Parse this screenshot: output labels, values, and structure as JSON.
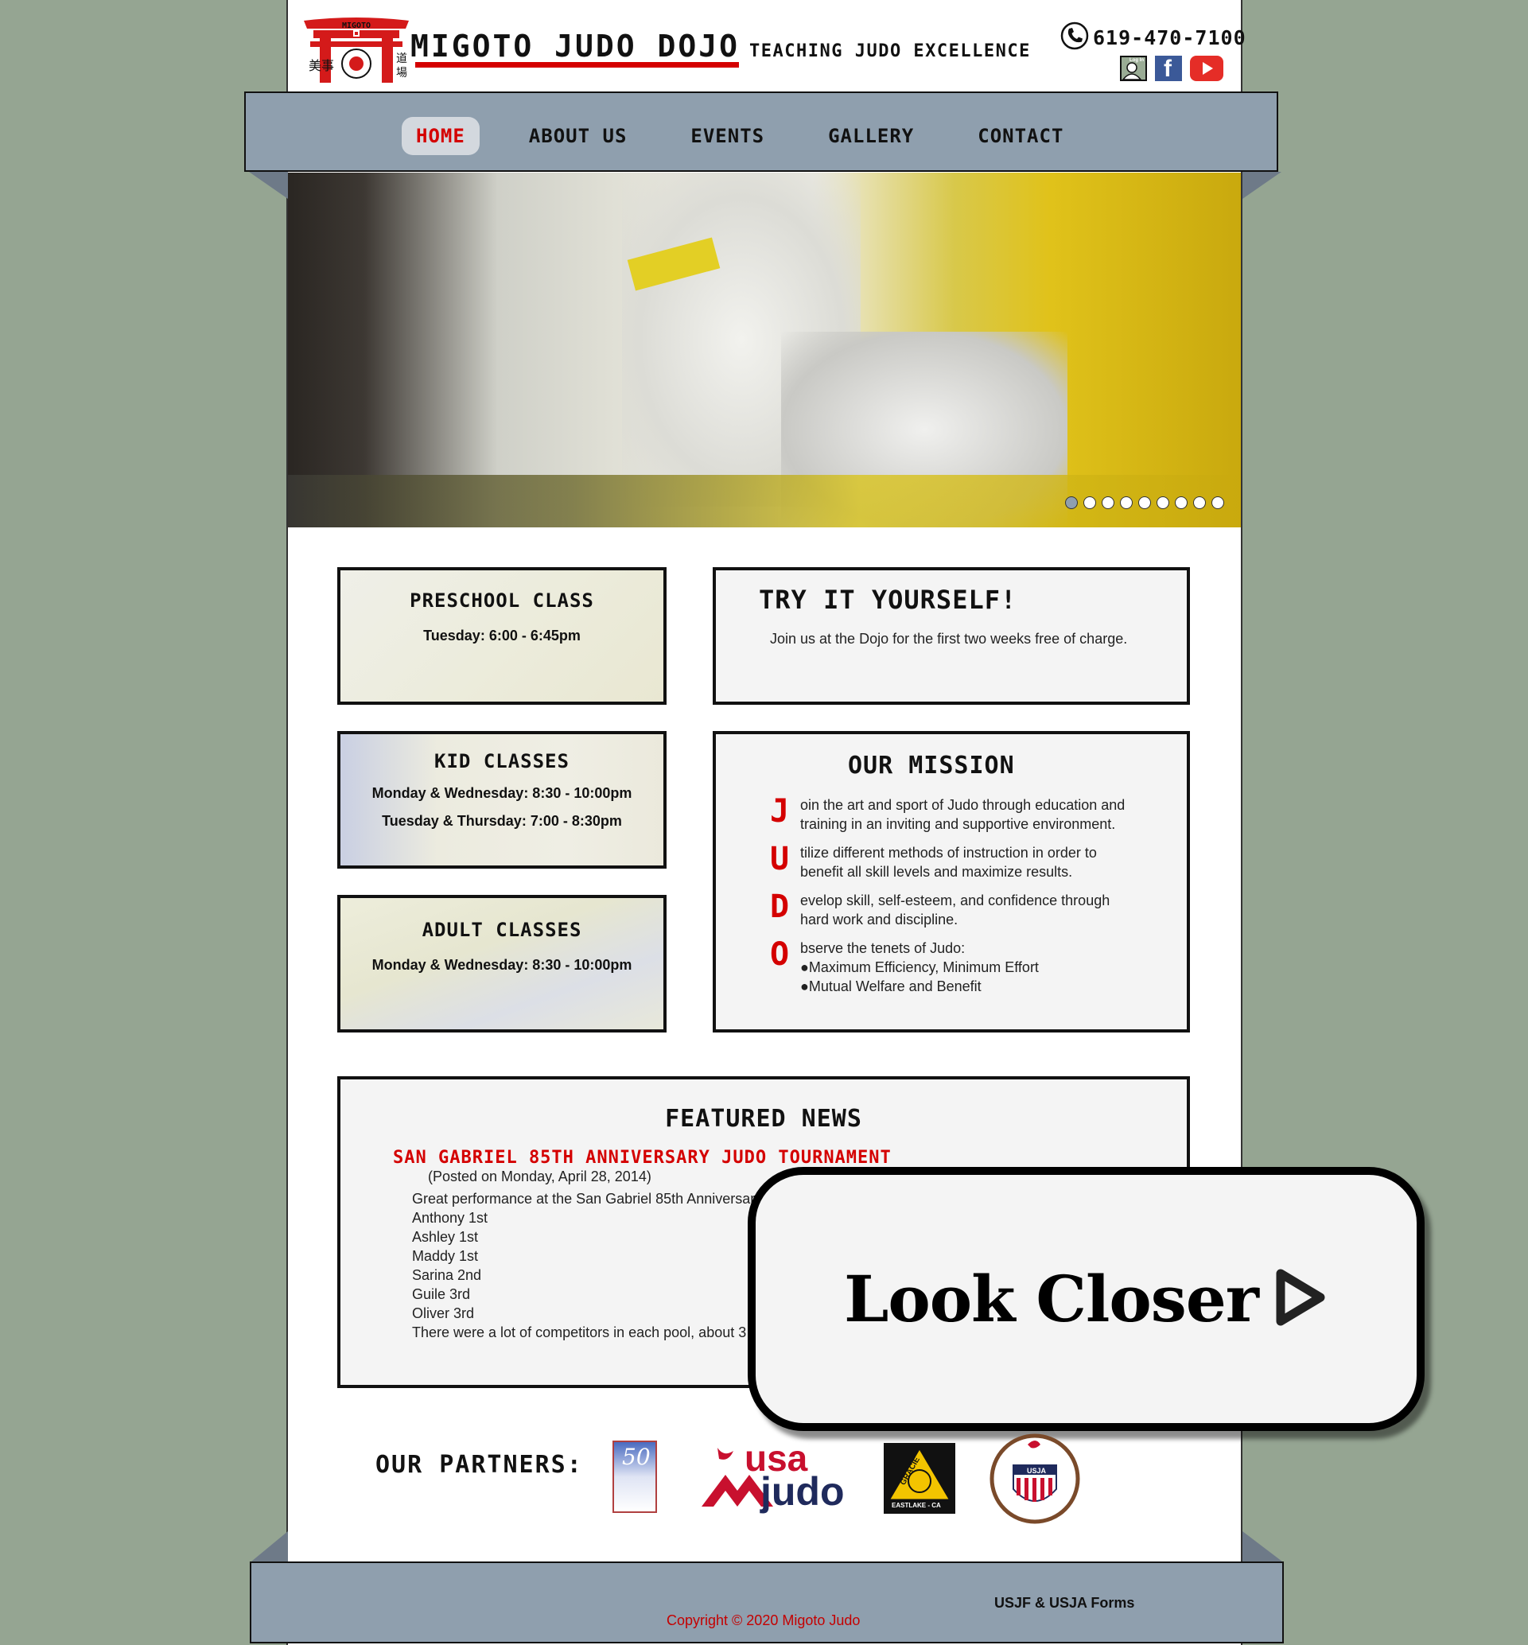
{
  "header": {
    "site_title": "Migoto Judo Dojo",
    "tagline": "Teaching Judo Excellence",
    "phone": "619-470-7100",
    "login_label": "Log In",
    "logo_text": "MIGOTO",
    "brand_red": "#d40000"
  },
  "nav": {
    "items": [
      {
        "label": "Home",
        "active": true
      },
      {
        "label": "About Us",
        "active": false
      },
      {
        "label": "Events",
        "active": false
      },
      {
        "label": "Gallery",
        "active": false
      },
      {
        "label": "Contact",
        "active": false
      }
    ]
  },
  "slideshow": {
    "slide_count": 9,
    "active_index": 0
  },
  "classes": [
    {
      "title": "Preschool Class",
      "schedule": [
        "Tuesday: 6:00 - 6:45pm"
      ]
    },
    {
      "title": "Kid Classes",
      "schedule": [
        "Monday & Wednesday: 8:30 - 10:00pm",
        "Tuesday & Thursday: 7:00 - 8:30pm"
      ]
    },
    {
      "title": "Adult Classes",
      "schedule": [
        "Monday & Wednesday: 8:30 - 10:00pm"
      ]
    }
  ],
  "try_it": {
    "title": "Try It Yourself!",
    "text": "Join us at the Dojo for the first two weeks free of charge."
  },
  "mission": {
    "title": "Our Mission",
    "items": [
      {
        "letter": "J",
        "lines": [
          "oin the art and sport of Judo through education and",
          "training in an inviting and supportive environment."
        ]
      },
      {
        "letter": "U",
        "lines": [
          "tilize different methods of instruction in order to",
          "benefit all skill levels and maximize results."
        ]
      },
      {
        "letter": "D",
        "lines": [
          "evelop skill, self-esteem, and confidence through",
          "hard work and discipline."
        ]
      },
      {
        "letter": "O",
        "lines": [
          "bserve the tenets of Judo:",
          "●Maximum Efficiency, Minimum Effort",
          "●Mutual Welfare and Benefit"
        ]
      }
    ]
  },
  "news": {
    "title": "Featured News",
    "headline": "San Gabriel 85th Anniversary Judo Tournament",
    "posted": "(Posted on Monday, April 28, 2014)",
    "lines": [
      "Great performance at the San Gabriel 85th Anniversary",
      "Anthony 1st",
      "Ashley 1st",
      "Maddy 1st",
      "Sarina 2nd",
      "Guile 3rd",
      "Oliver 3rd",
      "There were a lot of competitors in each pool, about 3"
    ]
  },
  "overlay": {
    "label": "Look Closer"
  },
  "partners": {
    "label": "Our Partners:",
    "logos": [
      {
        "name": "United States Judo Federation 50 Years",
        "text": "50"
      },
      {
        "name": "USA Judo",
        "text_top": "usa",
        "text_bottom": "judo"
      },
      {
        "name": "Gracie Jiu-Jitsu Eastlake CA",
        "text": "GRACIE",
        "sub": "EASTLAKE - CA"
      },
      {
        "name": "United States Judo Association",
        "text": "USJA"
      }
    ]
  },
  "footer": {
    "forms_link": "USJF & USJA Forms",
    "copyright": "Copyright © 2020 Migoto Judo"
  }
}
